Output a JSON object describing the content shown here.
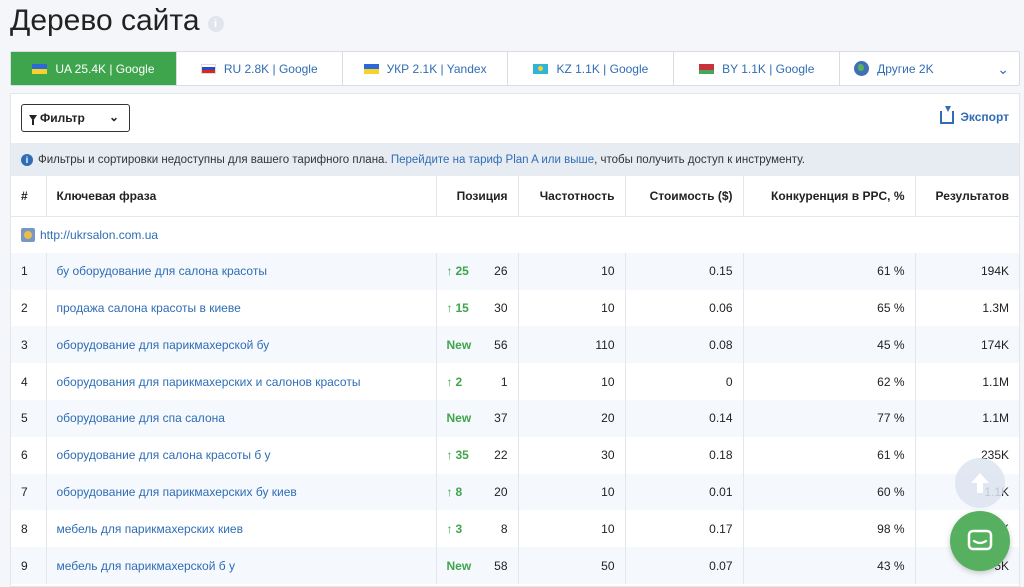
{
  "page": {
    "title": "Дерево сайта"
  },
  "tabs": [
    {
      "label": "UA 25.4K | Google",
      "flag": "ua",
      "active": true
    },
    {
      "label": "RU 2.8K | Google",
      "flag": "ru",
      "active": false
    },
    {
      "label": "УКР 2.1K | Yandex",
      "flag": "ua",
      "active": false
    },
    {
      "label": "KZ 1.1K | Google",
      "flag": "kz",
      "active": false
    },
    {
      "label": "BY 1.1K | Google",
      "flag": "by",
      "active": false
    },
    {
      "label": "Другие 2K",
      "flag": "globe",
      "active": false
    }
  ],
  "toolbar": {
    "filter_label": "Фильтр",
    "export_label": "Экспорт"
  },
  "notice": {
    "text_before": "Фильтры и сортировки недоступны для вашего тарифного плана. ",
    "link_text": "Перейдите на тариф Plan A или выше",
    "text_after": ", чтобы получить доступ к инструменту."
  },
  "table": {
    "headers": {
      "num": "#",
      "keyword": "Ключевая фраза",
      "position": "Позиция",
      "frequency": "Частотность",
      "cost": "Стоимость ($)",
      "competition": "Конкуренция в PPC, %",
      "results": "Результатов"
    },
    "site_url": "http://ukrsalon.com.ua",
    "rows": [
      {
        "num": "1",
        "keyword": "бу оборудование для салона красоты",
        "delta": "25",
        "new": false,
        "position": "26",
        "frequency": "10",
        "cost": "0.15",
        "competition": "61 %",
        "results": "194K"
      },
      {
        "num": "2",
        "keyword": "продажа салона красоты в киеве",
        "delta": "15",
        "new": false,
        "position": "30",
        "frequency": "10",
        "cost": "0.06",
        "competition": "65 %",
        "results": "1.3M"
      },
      {
        "num": "3",
        "keyword": "оборудование для парикмахерской бу",
        "delta": "New",
        "new": true,
        "position": "56",
        "frequency": "110",
        "cost": "0.08",
        "competition": "45 %",
        "results": "174K"
      },
      {
        "num": "4",
        "keyword": "оборудования для парикмахерских и салонов красоты",
        "delta": "2",
        "new": false,
        "position": "1",
        "frequency": "10",
        "cost": "0",
        "competition": "62 %",
        "results": "1.1M"
      },
      {
        "num": "5",
        "keyword": "оборудование для спа салона",
        "delta": "New",
        "new": true,
        "position": "37",
        "frequency": "20",
        "cost": "0.14",
        "competition": "77 %",
        "results": "1.1M"
      },
      {
        "num": "6",
        "keyword": "оборудование для салона красоты б у",
        "delta": "35",
        "new": false,
        "position": "22",
        "frequency": "30",
        "cost": "0.18",
        "competition": "61 %",
        "results": "235K"
      },
      {
        "num": "7",
        "keyword": "оборудование для парикмахерских бу киев",
        "delta": "8",
        "new": false,
        "position": "20",
        "frequency": "10",
        "cost": "0.01",
        "competition": "60 %",
        "results": "1.1K"
      },
      {
        "num": "8",
        "keyword": "мебель для парикмахерских киев",
        "delta": "3",
        "new": false,
        "position": "8",
        "frequency": "10",
        "cost": "0.17",
        "competition": "98 %",
        "results": "73K"
      },
      {
        "num": "9",
        "keyword": "мебель для парикмахерской б у",
        "delta": "New",
        "new": true,
        "position": "58",
        "frequency": "50",
        "cost": "0.07",
        "competition": "43 %",
        "results": "5K"
      }
    ]
  },
  "colors": {
    "accent": "#3fa54c",
    "link": "#2f6db5"
  }
}
